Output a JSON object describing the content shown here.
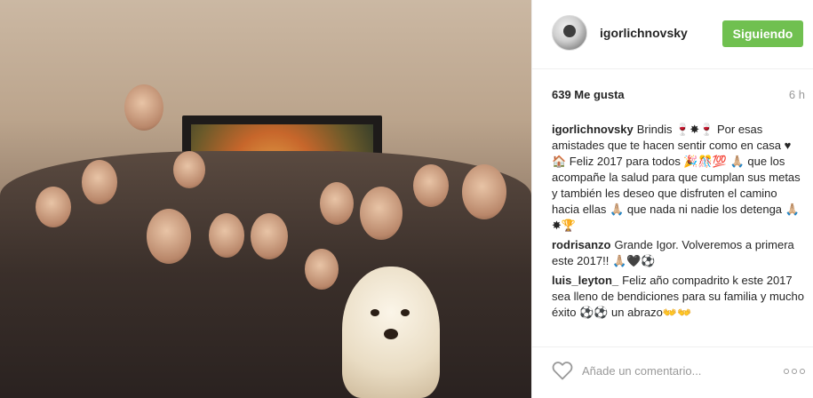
{
  "post": {
    "username": "igorlichnovsky",
    "follow_button": "Siguiendo",
    "likes": "639 Me gusta",
    "time": "6 h"
  },
  "comments": [
    {
      "author": "igorlichnovsky",
      "text": "Brindis 🍷✸🍷 Por esas amistades que te hacen sentir como en casa ♥🏠 Feliz 2017 para todos 🎉🎊💯 🙏🏼 que los acompañe la salud para que cumplan sus metas y también les deseo que disfruten el camino hacia ellas 🙏🏼 que nada ni nadie los detenga 🙏🏼✸🏆"
    },
    {
      "author": "rodrisanzo",
      "text": "Grande Igor. Volveremos a primera este 2017!! 🙏🏼🖤⚽"
    },
    {
      "author": "luis_leyton_",
      "text": "Feliz año compadrito k este 2017 sea lleno de bendiciones para su familia y mucho éxito ⚽⚽ un abrazo👐👐"
    }
  ],
  "footer": {
    "comment_placeholder": "Añade un comentario..."
  },
  "icons": {
    "heart": "heart-icon",
    "more": "more-options-icon",
    "avatar": "avatar"
  },
  "colors": {
    "follow_button": "#70c050",
    "muted_text": "#999999"
  }
}
